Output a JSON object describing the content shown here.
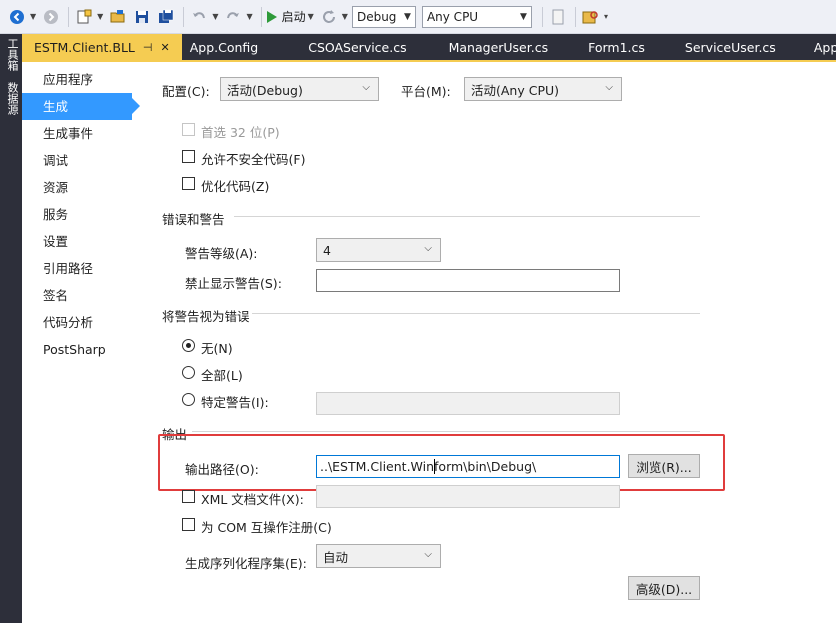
{
  "toolbar": {
    "start_label": "启动",
    "config_combo": "Debug",
    "cpu_combo": "Any CPU"
  },
  "toolstrip": {
    "items": [
      "工具箱",
      "数据源"
    ]
  },
  "tabs": [
    {
      "label": "ESTM.Client.BLL",
      "active": true
    },
    {
      "label": "App.Config"
    },
    {
      "label": "CSOAService.cs"
    },
    {
      "label": "ManagerUser.cs"
    },
    {
      "label": "Form1.cs"
    },
    {
      "label": "ServiceUser.cs"
    },
    {
      "label": "App.co"
    }
  ],
  "nav": {
    "items": [
      "应用程序",
      "生成",
      "生成事件",
      "调试",
      "资源",
      "服务",
      "设置",
      "引用路径",
      "签名",
      "代码分析",
      "PostSharp"
    ],
    "active_index": 1
  },
  "config_row": {
    "config_label": "配置(C):",
    "config_value": "活动(Debug)",
    "platform_label": "平台(M):",
    "platform_value": "活动(Any CPU)"
  },
  "general": {
    "prefer32_label": "首选 32 位(P)",
    "unsafe_label": "允许不安全代码(F)",
    "optimize_label": "优化代码(Z)"
  },
  "errors": {
    "section_title": "错误和警告",
    "warning_level_label": "警告等级(A):",
    "warning_level_value": "4",
    "suppress_label": "禁止显示警告(S):",
    "suppress_value": ""
  },
  "treat_warnings": {
    "section_title": "将警告视为错误",
    "none_label": "无(N)",
    "all_label": "全部(L)",
    "specific_label": "特定警告(I):",
    "selected": "none"
  },
  "output": {
    "section_title": "输出",
    "path_label": "输出路径(O):",
    "path_value": "..\\ESTM.Client.Winform\\bin\\Debug\\",
    "browse_label": "浏览(R)...",
    "xml_label": "XML 文档文件(X):",
    "com_label": "为 COM 互操作注册(C)",
    "serialization_label": "生成序列化程序集(E):",
    "serialization_value": "自动",
    "advanced_label": "高级(D)..."
  },
  "colors": {
    "accent": "#3399ff",
    "tab_active": "#f5cc52",
    "highlight_box": "#e03c3c",
    "chrome_dark": "#2d2f3a"
  }
}
